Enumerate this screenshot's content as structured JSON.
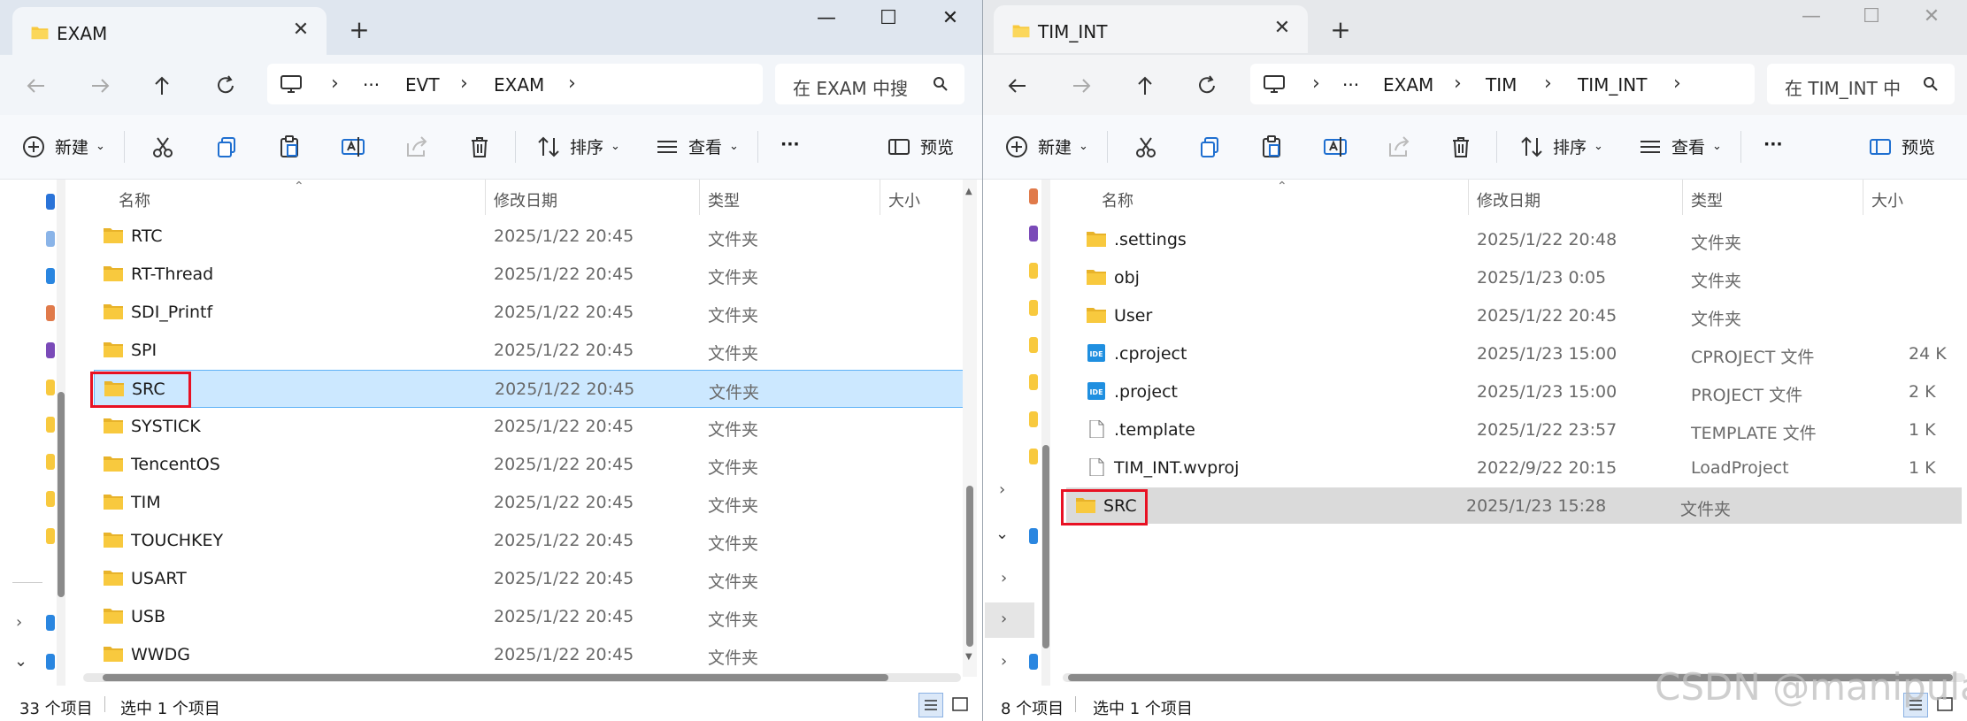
{
  "colors": {
    "folder": "#f8c93e",
    "selected": "#cce8ff",
    "highlight": "#dadada",
    "redbox": "#e81123",
    "ide": "#1f8fe0"
  },
  "left": {
    "tab_title": "EXAM",
    "breadcrumb": [
      "···",
      "EVT",
      "EXAM"
    ],
    "search_placeholder": "在 EXAM 中搜",
    "toolbar": {
      "new": "新建",
      "sort": "排序",
      "view": "查看",
      "more": "···",
      "preview": "预览"
    },
    "columns": {
      "name": "名称",
      "date": "修改日期",
      "type": "类型",
      "size": "大小"
    },
    "files": [
      {
        "name": "RTC",
        "date": "2025/1/22 20:45",
        "type": "文件夹",
        "size": ""
      },
      {
        "name": "RT-Thread",
        "date": "2025/1/22 20:45",
        "type": "文件夹",
        "size": ""
      },
      {
        "name": "SDI_Printf",
        "date": "2025/1/22 20:45",
        "type": "文件夹",
        "size": ""
      },
      {
        "name": "SPI",
        "date": "2025/1/22 20:45",
        "type": "文件夹",
        "size": ""
      },
      {
        "name": "SRC",
        "date": "2025/1/22 20:45",
        "type": "文件夹",
        "size": ""
      },
      {
        "name": "SYSTICK",
        "date": "2025/1/22 20:45",
        "type": "文件夹",
        "size": ""
      },
      {
        "name": "TencentOS",
        "date": "2025/1/22 20:45",
        "type": "文件夹",
        "size": ""
      },
      {
        "name": "TIM",
        "date": "2025/1/22 20:45",
        "type": "文件夹",
        "size": ""
      },
      {
        "name": "TOUCHKEY",
        "date": "2025/1/22 20:45",
        "type": "文件夹",
        "size": ""
      },
      {
        "name": "USART",
        "date": "2025/1/22 20:45",
        "type": "文件夹",
        "size": ""
      },
      {
        "name": "USB",
        "date": "2025/1/22 20:45",
        "type": "文件夹",
        "size": ""
      },
      {
        "name": "WWDG",
        "date": "2025/1/22 20:45",
        "type": "文件夹",
        "size": ""
      }
    ],
    "status": {
      "count": "33 个项目",
      "selection": "选中 1 个项目"
    }
  },
  "right": {
    "tab_title": "TIM_INT",
    "breadcrumb": [
      "···",
      "EXAM",
      "TIM",
      "TIM_INT"
    ],
    "search_placeholder": "在 TIM_INT 中",
    "toolbar": {
      "new": "新建",
      "sort": "排序",
      "view": "查看",
      "more": "···",
      "preview": "预览"
    },
    "columns": {
      "name": "名称",
      "date": "修改日期",
      "type": "类型",
      "size": "大小"
    },
    "files": [
      {
        "name": ".settings",
        "date": "2025/1/22 20:48",
        "type": "文件夹",
        "size": "",
        "icon": "folder"
      },
      {
        "name": "obj",
        "date": "2025/1/23 0:05",
        "type": "文件夹",
        "size": "",
        "icon": "folder"
      },
      {
        "name": "User",
        "date": "2025/1/22 20:45",
        "type": "文件夹",
        "size": "",
        "icon": "folder"
      },
      {
        "name": ".cproject",
        "date": "2025/1/23 15:00",
        "type": "CPROJECT 文件",
        "size": "24 K",
        "icon": "ide"
      },
      {
        "name": ".project",
        "date": "2025/1/23 15:00",
        "type": "PROJECT 文件",
        "size": "2 K",
        "icon": "ide"
      },
      {
        "name": ".template",
        "date": "2025/1/22 23:57",
        "type": "TEMPLATE 文件",
        "size": "1 K",
        "icon": "file"
      },
      {
        "name": "TIM_INT.wvproj",
        "date": "2022/9/22 20:15",
        "type": "LoadProject",
        "size": "1 K",
        "icon": "file"
      },
      {
        "name": "SRC",
        "date": "2025/1/23 15:28",
        "type": "文件夹",
        "size": "",
        "icon": "folder"
      }
    ],
    "status": {
      "count": "8 个项目",
      "selection": "选中 1 个项目"
    }
  },
  "watermark": "CSDN @manipulat",
  "ide_label": "IDE"
}
